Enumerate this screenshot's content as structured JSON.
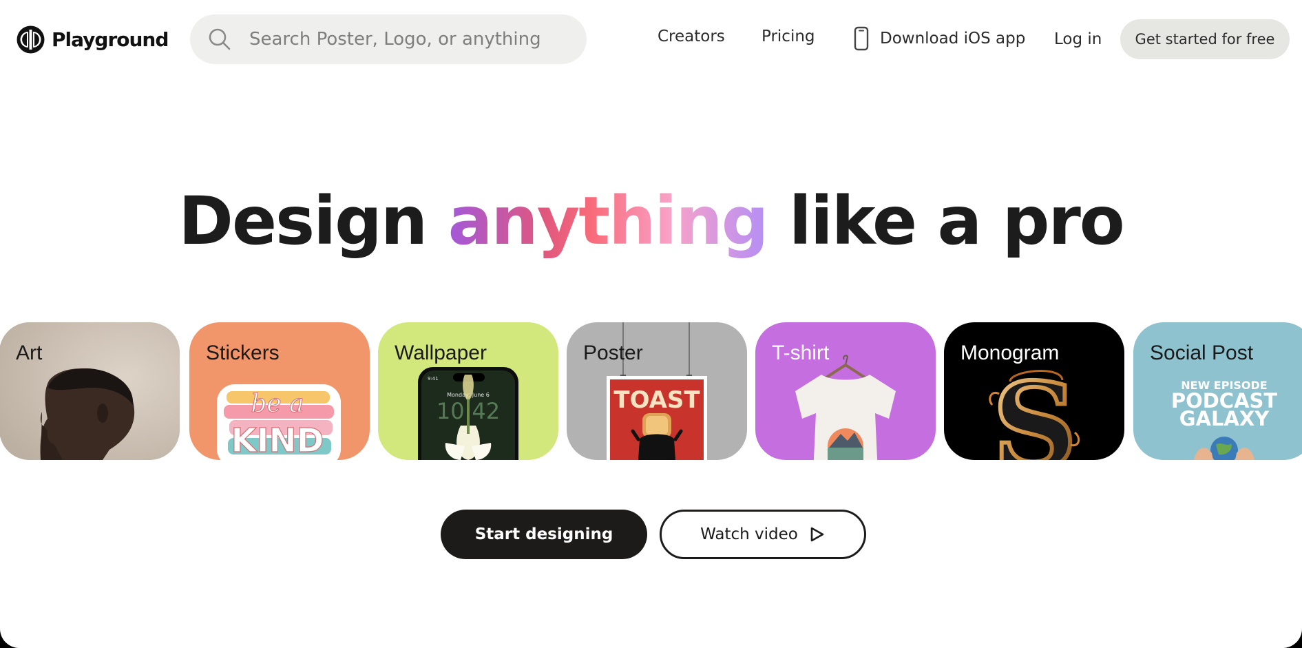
{
  "header": {
    "brand": "Playground",
    "search": {
      "placeholder": "Search Poster, Logo, or anything",
      "value": ""
    },
    "nav": {
      "creators": "Creators",
      "pricing": "Pricing",
      "ios": "Download iOS app",
      "login": "Log in",
      "cta": "Get started for free"
    }
  },
  "hero": {
    "title_before": "Design ",
    "title_highlight": "anything",
    "title_after": " like a pro"
  },
  "cards": [
    {
      "label": "Art",
      "bg": "#cfc4b7"
    },
    {
      "label": "Stickers",
      "bg": "#f1956a",
      "art_text": [
        "be a",
        "KIND"
      ]
    },
    {
      "label": "Wallpaper",
      "bg": "#d2e87c",
      "art_text": [
        "9:41",
        "Monday, June 6",
        "10:42"
      ]
    },
    {
      "label": "Poster",
      "bg": "#b2b2b2",
      "art_text": [
        "TOAST"
      ]
    },
    {
      "label": "T-shirt",
      "bg": "#c46ee0"
    },
    {
      "label": "Monogram",
      "bg": "#000000"
    },
    {
      "label": "Social Post",
      "bg": "#8ec2cf",
      "art_text": [
        "NEW EPISODE",
        "PODCAST",
        "GALAXY"
      ]
    }
  ],
  "actions": {
    "start": "Start designing",
    "watch": "Watch video"
  },
  "colors": {
    "page_bg": "#ffffff",
    "text": "#1c1c1c",
    "search_bg": "#efefed",
    "cta_bg": "#e6e6e3",
    "primary_button": "#1c1b1a"
  },
  "icons": [
    "playground-logo-icon",
    "search-icon",
    "phone-icon",
    "play-icon"
  ]
}
